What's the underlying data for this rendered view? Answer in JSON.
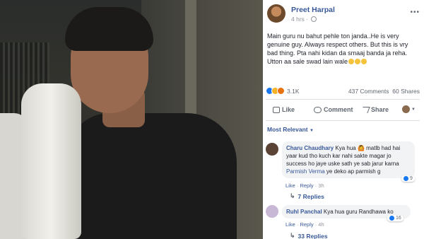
{
  "post": {
    "author": "Preet Harpal",
    "time": "4 hrs",
    "text": "Main guru nu bahut pehle ton janda..He is very genuine guy. Always respect others. But this is vry bad thing. Pta nahi kidan da smaaj banda ja reha. Utton aa sale swad lain wale",
    "reactions_count": "3.1K",
    "comments_count": "437 Comments",
    "shares_count": "60 Shares",
    "actions": {
      "like": "Like",
      "comment": "Comment",
      "share": "Share"
    },
    "sort_label": "Most Relevant"
  },
  "comments": [
    {
      "name": "Charu Chaudhary",
      "text": "Kya hua 🙆 matlb had hai yaar kud tho kuch kar nahi sakte magar jo success ho jaye uske sath ye sab jarur karna",
      "tag": "Parmish Verma",
      "text_after": "ye deko ap parmish g",
      "likes": "9",
      "like": "Like",
      "reply": "Reply",
      "time": "3h",
      "replies": "7 Replies"
    },
    {
      "name": "Ruhl Panchal",
      "text": "Kya hua guru Randhawa ko",
      "likes": "16",
      "like": "Like",
      "reply": "Reply",
      "time": "4h",
      "replies": "33 Replies"
    }
  ]
}
